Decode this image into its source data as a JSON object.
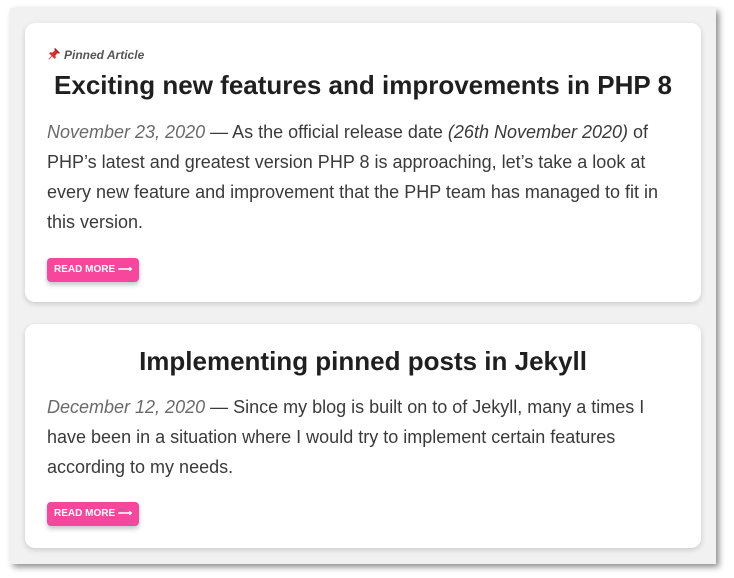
{
  "posts": [
    {
      "pinned_label": "Pinned Article",
      "pin_icon": "pushpin-icon",
      "title": "Exciting new features and improvements in PHP 8",
      "date": "November 23, 2020",
      "excerpt_before": " — As the official release date ",
      "excerpt_emphasis": "(26th November 2020)",
      "excerpt_after": " of PHP’s latest and greatest version PHP 8 is approaching, let’s take a look at every new feature and improvement that the PHP team has managed to fit in this version.",
      "read_more_label": "READ MORE ⟶"
    },
    {
      "title": "Implementing pinned posts in Jekyll",
      "date": "December 12, 2020",
      "excerpt": " — Since my blog is built on to of Jekyll, many a times I have been in a situation where I would try to implement certain features according to my needs.",
      "read_more_label": "READ MORE ⟶"
    }
  ],
  "colors": {
    "accent": "#f7479d",
    "page_background": "#f1f1f2",
    "card_background": "#ffffff",
    "title_text": "#1f1f1f",
    "body_text": "#3a3a3a",
    "date_text": "#6a6a6a",
    "pin_red": "#d32f2f"
  }
}
